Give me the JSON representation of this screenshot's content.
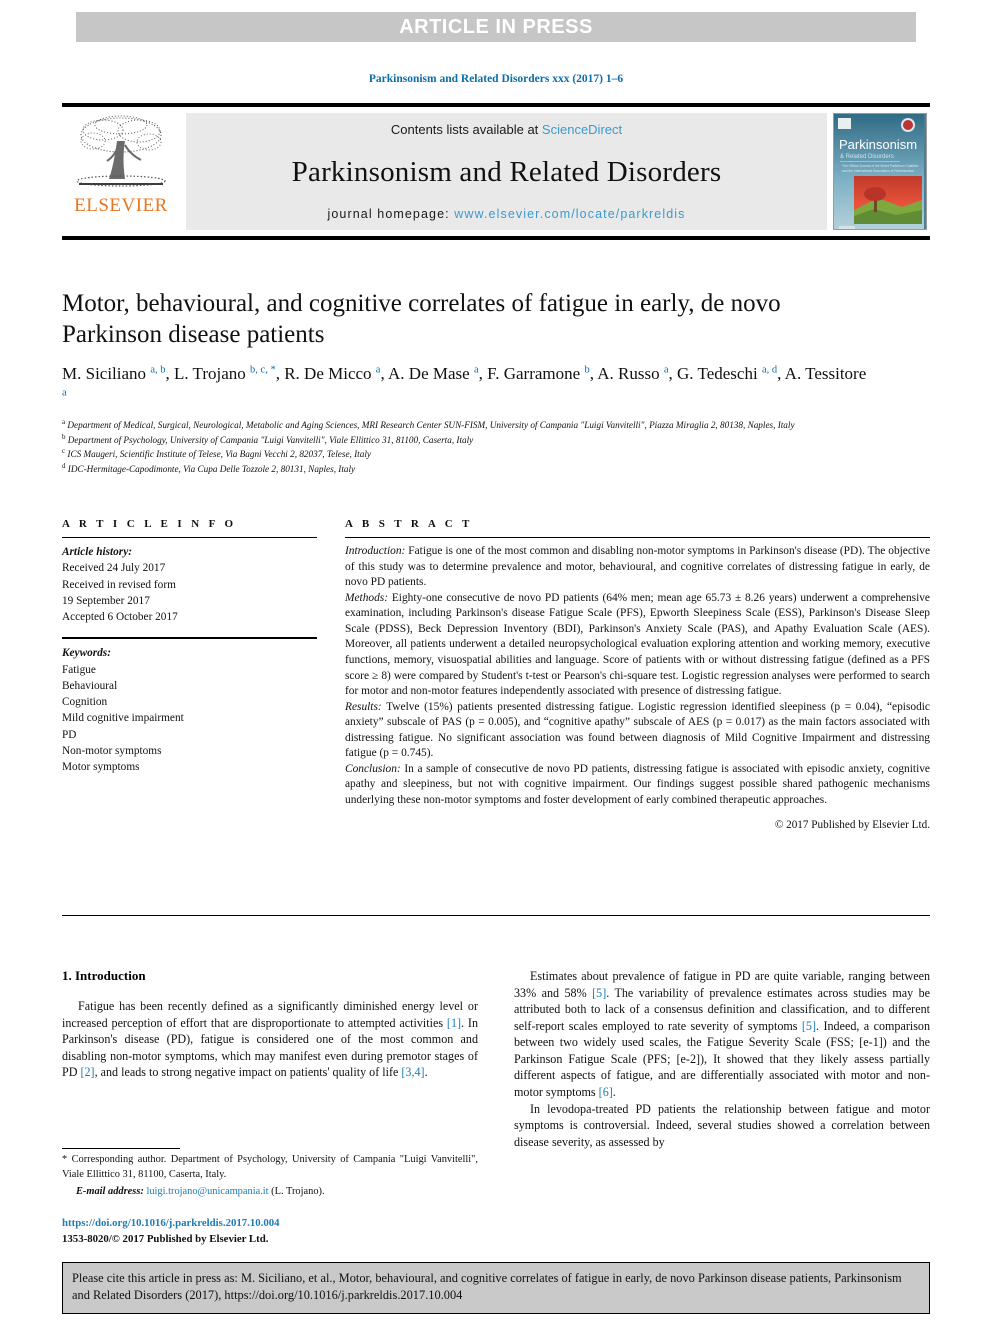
{
  "banner": {
    "label": "ARTICLE IN PRESS"
  },
  "journal_ref": "Parkinsonism and Related Disorders xxx (2017) 1–6",
  "masthead": {
    "contents_prefix": "Contents lists available at",
    "contents_link": "ScienceDirect",
    "journal_title": "Parkinsonism and Related Disorders",
    "homepage_label": "journal homepage:",
    "homepage_url": "www.elsevier.com/locate/parkreldis",
    "publisher_wordmark": "ELSEVIER",
    "publisher_logo_icon": "elsevier-tree-icon",
    "cover_title": "Parkinsonism",
    "cover_subtitle": "& Related Disorders",
    "accent_link_color": "#3a9bd0",
    "publisher_orange": "#e87722"
  },
  "article": {
    "title": "Motor, behavioural, and cognitive correlates of fatigue in early, de novo Parkinson disease patients",
    "authors_html": "M. Siciliano <sup>a, b</sup>, L. Trojano <sup>b, c, *</sup>, R. De Micco <sup>a</sup>, A. De Mase <sup>a</sup>, F. Garramone <sup>b</sup>, A. Russo <sup>a</sup>, G. Tedeschi <sup>a, d</sup>, A. Tessitore <sup>a</sup>",
    "affiliations": [
      {
        "marker": "a",
        "text": "Department of Medical, Surgical, Neurological, Metabolic and Aging Sciences, MRI Research Center SUN-FISM, University of Campania \"Luigi Vanvitelli\", Piazza Miraglia 2, 80138, Naples, Italy"
      },
      {
        "marker": "b",
        "text": "Department of Psychology, University of Campania \"Luigi Vanvitelli\", Viale Ellittico 31, 81100, Caserta, Italy"
      },
      {
        "marker": "c",
        "text": "ICS Maugeri, Scientific Institute of Telese, Via Bagni Vecchi 2, 82037, Telese, Italy"
      },
      {
        "marker": "d",
        "text": "IDC-Hermitage-Capodimonte, Via Cupa Delle Tozzole 2, 80131, Naples, Italy"
      }
    ]
  },
  "article_info": {
    "heading": "A R T I C L E  I N F O",
    "history_label": "Article history:",
    "history_lines": [
      "Received 24 July 2017",
      "Received in revised form",
      "19 September 2017",
      "Accepted 6 October 2017"
    ],
    "keywords_label": "Keywords:",
    "keywords": [
      "Fatigue",
      "Behavioural",
      "Cognition",
      "Mild cognitive impairment",
      "PD",
      "Non-motor symptoms",
      "Motor symptoms"
    ]
  },
  "abstract": {
    "heading": "A B S T R A C T",
    "sections": [
      {
        "label": "Introduction:",
        "text": " Fatigue is one of the most common and disabling non-motor symptoms in Parkinson's disease (PD). The objective of this study was to determine prevalence and motor, behavioural, and cognitive correlates of distressing fatigue in early, de novo PD patients."
      },
      {
        "label": "Methods:",
        "text": " Eighty-one consecutive de novo PD patients (64% men; mean age 65.73 ± 8.26 years) underwent a comprehensive examination, including Parkinson's disease Fatigue Scale (PFS), Epworth Sleepiness Scale (ESS), Parkinson's Disease Sleep Scale (PDSS), Beck Depression Inventory (BDI), Parkinson's Anxiety Scale (PAS), and Apathy Evaluation Scale (AES). Moreover, all patients underwent a detailed neuropsychological evaluation exploring attention and working memory, executive functions, memory, visuospatial abilities and language. Score of patients with or without distressing fatigue (defined as a PFS score ≥ 8) were compared by Student's t-test or Pearson's chi-square test. Logistic regression analyses were performed to search for motor and non-motor features independently associated with presence of distressing fatigue."
      },
      {
        "label": "Results:",
        "text": " Twelve (15%) patients presented distressing fatigue. Logistic regression identified sleepiness (p = 0.04), “episodic anxiety” subscale of PAS (p = 0.005), and “cognitive apathy” subscale of AES (p = 0.017) as the main factors associated with distressing fatigue. No significant association was found between diagnosis of Mild Cognitive Impairment and distressing fatigue (p = 0.745)."
      },
      {
        "label": "Conclusion:",
        "text": " In a sample of consecutive de novo PD patients, distressing fatigue is associated with episodic anxiety, cognitive apathy and sleepiness, but not with cognitive impairment. Our findings suggest possible shared pathogenic mechanisms underlying these non-motor symptoms and foster development of early combined therapeutic approaches."
      }
    ],
    "copyright": "© 2017 Published by Elsevier Ltd."
  },
  "body": {
    "section_heading": "1. Introduction",
    "left_paragraph_html": "Fatigue has been recently defined as a significantly diminished energy level or increased perception of effort that are disproportionate to attempted activities <span class=\"ref\">[1]</span>. In Parkinson's disease (PD), fatigue is considered one of the most common and disabling non-motor symptoms, which may manifest even during premotor stages of PD <span class=\"ref\">[2]</span>, and leads to strong negative impact on patients' quality of life <span class=\"ref\">[3,4]</span>.",
    "right_paragraph_1_html": "Estimates about prevalence of fatigue in PD are quite variable, ranging between 33% and 58% <span class=\"ref\">[5]</span>. The variability of prevalence estimates across studies may be attributed both to lack of a consensus definition and classification, and to different self-report scales employed to rate severity of symptoms <span class=\"ref\">[5]</span>. Indeed, a comparison between two widely used scales, the Fatigue Severity Scale (FSS; [e-1]) and the Parkinson Fatigue Scale (PFS; [e-2]), It showed that they likely assess partially different aspects of fatigue, and are differentially associated with motor and non-motor symptoms <span class=\"ref\">[6]</span>.",
    "right_paragraph_2_html": "In levodopa-treated PD patients the relationship between fatigue and motor symptoms is controversial. Indeed, several studies showed a correlation between disease severity, as assessed by"
  },
  "footnote": {
    "corresponding_text": "* Corresponding author. Department of Psychology, University of Campania \"Luigi Vanvitelli\", Viale Ellittico 31, 81100, Caserta, Italy.",
    "email_label": "E-mail address:",
    "email": "luigi.trojano@unicampania.it",
    "email_owner": "(L. Trojano)."
  },
  "doi_block": {
    "doi_link": "https://doi.org/10.1016/j.parkreldis.2017.10.004",
    "issn_line": "1353-8020/© 2017 Published by Elsevier Ltd."
  },
  "citation_box": {
    "text": "Please cite this article in press as: M. Siciliano, et al., Motor, behavioural, and cognitive correlates of fatigue in early, de novo Parkinson disease patients, Parkinsonism and Related Disorders (2017), https://doi.org/10.1016/j.parkreldis.2017.10.004"
  }
}
